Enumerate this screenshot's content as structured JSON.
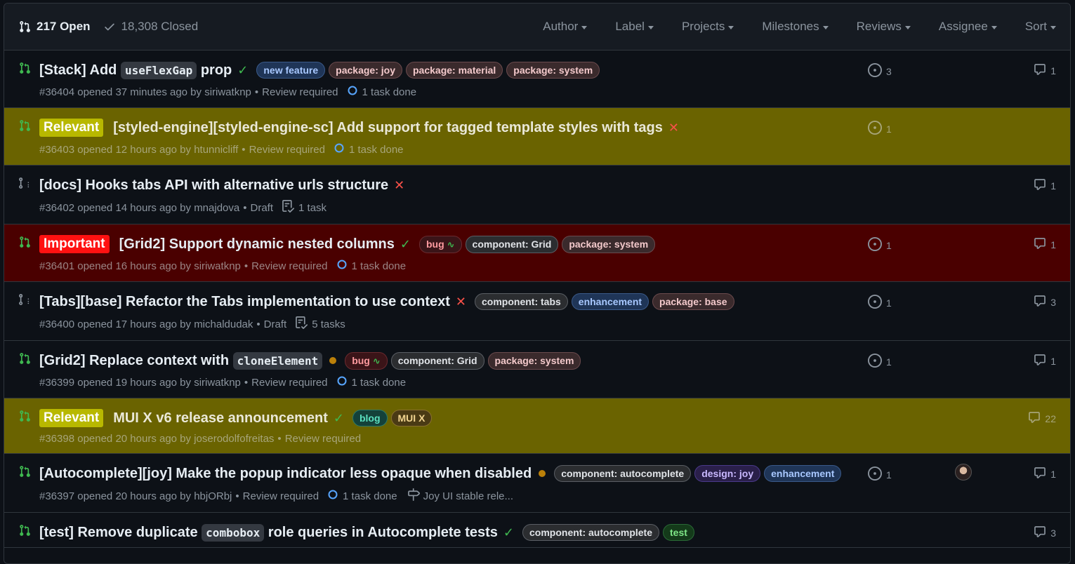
{
  "header": {
    "open_count": "217 Open",
    "closed_count": "18,308 Closed",
    "filters": [
      "Author",
      "Label",
      "Projects",
      "Milestones",
      "Reviews",
      "Assignee",
      "Sort"
    ]
  },
  "rows": [
    {
      "title_parts": [
        "[Stack] Add ",
        "useFlexGap",
        " prop"
      ],
      "status": "check",
      "labels": [
        "new feature",
        "package: joy",
        "package: material",
        "package: system"
      ],
      "meta_main": "#36404 opened 37 minutes ago by siriwatknp",
      "review": "Review required",
      "tasks": "1 task done",
      "issues": "3",
      "comments": "1"
    },
    {
      "badge": "Relevant",
      "title": "[styled-engine][styled-engine-sc] Add support for tagged template styles with tags",
      "status": "cross",
      "meta_main": "#36403 opened 12 hours ago by htunnicliff",
      "review": "Review required",
      "tasks": "1 task done",
      "issues": "1"
    },
    {
      "title": "[docs] Hooks tabs API with alternative urls structure",
      "status": "cross",
      "meta_main": "#36402 opened 14 hours ago by mnajdova",
      "review": "Draft",
      "tasks": "1 task",
      "comments": "1"
    },
    {
      "badge": "Important",
      "title": "[Grid2] Support dynamic nested columns",
      "status": "check",
      "labels": [
        "bug",
        "component: Grid",
        "package: system"
      ],
      "meta_main": "#36401 opened 16 hours ago by siriwatknp",
      "review": "Review required",
      "tasks": "1 task done",
      "issues": "1",
      "comments": "1"
    },
    {
      "title": "[Tabs][base] Refactor the Tabs implementation to use context",
      "status": "cross",
      "labels": [
        "component: tabs",
        "enhancement",
        "package: base"
      ],
      "meta_main": "#36400 opened 17 hours ago by michaldudak",
      "review": "Draft",
      "tasks": "5 tasks",
      "issues": "1",
      "comments": "3"
    },
    {
      "title_parts": [
        "[Grid2] Replace context with ",
        "cloneElement",
        ""
      ],
      "status": "dot",
      "labels": [
        "bug",
        "component: Grid",
        "package: system"
      ],
      "meta_main": "#36399 opened 19 hours ago by siriwatknp",
      "review": "Review required",
      "tasks": "1 task done",
      "issues": "1",
      "comments": "1"
    },
    {
      "badge": "Relevant",
      "title": "MUI X v6 release announcement",
      "status": "check",
      "labels": [
        "blog",
        "MUI X"
      ],
      "meta_main": "#36398 opened 20 hours ago by joserodolfofreitas",
      "review": "Review required",
      "comments": "22"
    },
    {
      "title": "[Autocomplete][joy] Make the popup indicator less opaque when disabled",
      "status": "dot",
      "labels": [
        "component: autocomplete",
        "design: joy",
        "enhancement"
      ],
      "meta_main": "#36397 opened 20 hours ago by hbjORbj",
      "review": "Review required",
      "tasks": "1 task done",
      "milestone": "Joy UI stable rele...",
      "issues": "1",
      "comments": "1"
    },
    {
      "title_parts": [
        "[test] Remove duplicate ",
        "combobox",
        " role queries in Autocomplete tests"
      ],
      "status": "check",
      "labels": [
        "component: autocomplete",
        "test"
      ],
      "comments": "3"
    }
  ],
  "colors": {
    "relevant_bg": "#6a6300",
    "important_bg": "#4a0000",
    "open_green": "#3fb950",
    "fail_red": "#f85149",
    "pending_orange": "#bb8009"
  }
}
